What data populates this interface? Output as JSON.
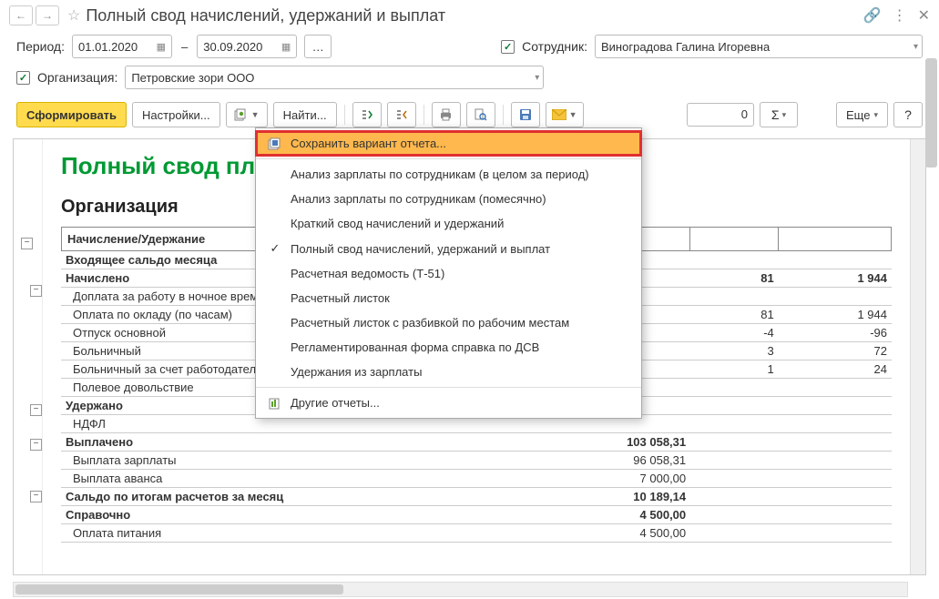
{
  "title": "Полный свод начислений, удержаний и выплат",
  "period_label": "Период:",
  "date_from": "01.01.2020",
  "date_to": "30.09.2020",
  "dash": "–",
  "employee_label": "Сотрудник:",
  "employee_value": "Виноградова Галина Игоревна",
  "org_label": "Организация:",
  "org_value": "Петровские зори ООО",
  "btn_form": "Сформировать",
  "btn_settings": "Настройки...",
  "btn_find": "Найти...",
  "numbox": "0",
  "btn_more": "Еще",
  "report_title": "Полный свод                                                           плат",
  "report_org_label": "Организация",
  "header_col1": "Начисление/Удержание",
  "rows": {
    "r0": "Входящее сальдо месяца",
    "r1": "Начислено",
    "r1v2": "81",
    "r1v3": "1 944",
    "r2": "Доплата за работу в ночное время",
    "r3": "Оплата по окладу (по часам)",
    "r3v2": "81",
    "r3v3": "1 944",
    "r4": "Отпуск основной",
    "r4v2": "-4",
    "r4v3": "-96",
    "r5": "Больничный",
    "r5v2": "3",
    "r5v3": "72",
    "r6": "Больничный за счет работодателя",
    "r6v2": "1",
    "r6v3": "24",
    "r7": "Полевое довольствие",
    "r8": "Удержано",
    "r9": "НДФЛ",
    "r10": "Выплачено",
    "r10v1": "103 058,31",
    "r11": "Выплата зарплаты",
    "r11v1": "96 058,31",
    "r12": "Выплата аванса",
    "r12v1": "7 000,00",
    "r13": "Сальдо по итогам расчетов за месяц",
    "r13v1": "10 189,14",
    "r14": "Справочно",
    "r14v1": "4 500,00",
    "r15": "Оплата питания",
    "r15v1": "4 500,00"
  },
  "menu": {
    "save": "Сохранить вариант отчета...",
    "m1": "Анализ зарплаты по сотрудникам (в целом за период)",
    "m2": "Анализ зарплаты по сотрудникам (помесячно)",
    "m3": "Краткий свод начислений и удержаний",
    "m4": "Полный свод начислений, удержаний и выплат",
    "m5": "Расчетная ведомость (Т-51)",
    "m6": "Расчетный листок",
    "m7": "Расчетный листок с разбивкой по рабочим местам",
    "m8": "Регламентированная форма справка по ДСВ",
    "m9": "Удержания из зарплаты",
    "other": "Другие отчеты..."
  }
}
